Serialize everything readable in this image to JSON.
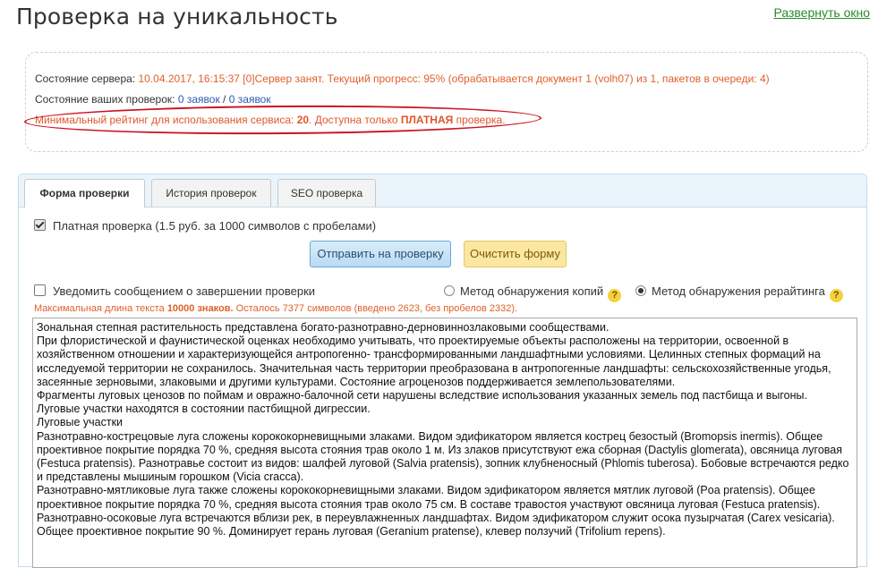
{
  "header": {
    "title": "Проверка на уникальность",
    "expand_link": "Развернуть окно"
  },
  "status": {
    "server_label": "Состояние сервера:",
    "server_value": "10.04.2017, 16:15:37 [0]Сервер занят. Текущий прогресс: 95% (обрабатывается документ 1 (volh07) из 1, пакетов в очереди: 4)",
    "checks_label": "Состояние ваших проверок:",
    "checks_count1": "0",
    "checks_link1": "заявок",
    "checks_sep": "/",
    "checks_count2": "0",
    "checks_link2": "заявок",
    "rating_prefix": "Минимальный рейтинг для использования сервиса:",
    "rating_value": "20",
    "rating_mid": ". Доступна только",
    "rating_paid": "ПЛАТНАЯ",
    "rating_suffix": "проверка."
  },
  "tabs": [
    {
      "label": "Форма проверки",
      "active": true
    },
    {
      "label": "История проверок",
      "active": false
    },
    {
      "label": "SEO проверка",
      "active": false
    }
  ],
  "form": {
    "paid_check_label": "Платная проверка (1.5 руб. за 1000 символов с пробелами)",
    "paid_checked": true,
    "submit_label": "Отправить на проверку",
    "clear_label": "Очистить форму",
    "notify_label": "Уведомить сообщением о завершении проверки",
    "notify_checked": false,
    "method_copies": "Метод обнаружения копий",
    "method_rewrite": "Метод обнаружения рерайтинга",
    "method_selected": "rewrite",
    "help_glyph": "?",
    "maxlen_prefix": "Максимальная длина текста",
    "maxlen_value": "10000 знаков.",
    "maxlen_suffix": "Осталось 7377 символов (введено 2623, без пробелов 2332)."
  },
  "text_lines": [
    "Зональная степная растительность представлена богато-разнотравно-дерновиннозлаковыми сообществами.",
    "При флористической и фаунистической оценках необходимо учитывать, что проектируемые объекты расположены на территории, освоенной в хозяйственном отношении и характеризующейся антропогенно- трансформированными ландшафтными условиями. Целинных степных формаций на исследуемой территории не сохранилось. Значительная часть территории преобразована в антропогенные ландшафты: сельскохозяйственные угодья, засеянные зерновыми, злаковыми и другими культурами. Состояние агроценозов поддерживается землепользователями.",
    "Фрагменты луговых ценозов по поймам и овражно-балочной сети нарушены вследствие использования указанных земель под пастбища и выгоны. Луговые участки находятся в состоянии пастбищной дигрессии.",
    "Луговые участки",
    "Разнотравно-кострецовые луга сложены корококорневищными злаками. Видом эдификатором является кострец безостый (Bromopsis inermis). Общее проективное покрытие порядка 70 %, средняя высота стояния трав около 1 м. Из злаков присутствуют ежа сборная (Dactylis glomerata), овсяница луговая (Festuca pratensis). Разнотравье состоит из видов: шалфей луговой (Salvia pratensis), зопник клубненосный (Phlomis tuberosa). Бобовые встречаются редко и представлены мышиным горошком (Vicia cracca).",
    "Разнотравно-мятликовые луга также сложены корококорневищными злаками. Видом эдификатором является мятлик луговой (Poa pratensis). Общее проективное покрытие порядка 70 %, средняя высота стояния трав около 75 см. В составе травостоя участвуют овсяница луговая (Festuca pratensis).",
    "Разнотравно-осоковые луга встречаются вблизи рек, в переувлажненных ландшафтах. Видом эдификатором служит осока пузырчатая (Carex vesicaria). Общее проективное покрытие 90 %. Доминирует герань луговая (Geranium pratense), клевер ползучий (Trifolium repens)."
  ]
}
